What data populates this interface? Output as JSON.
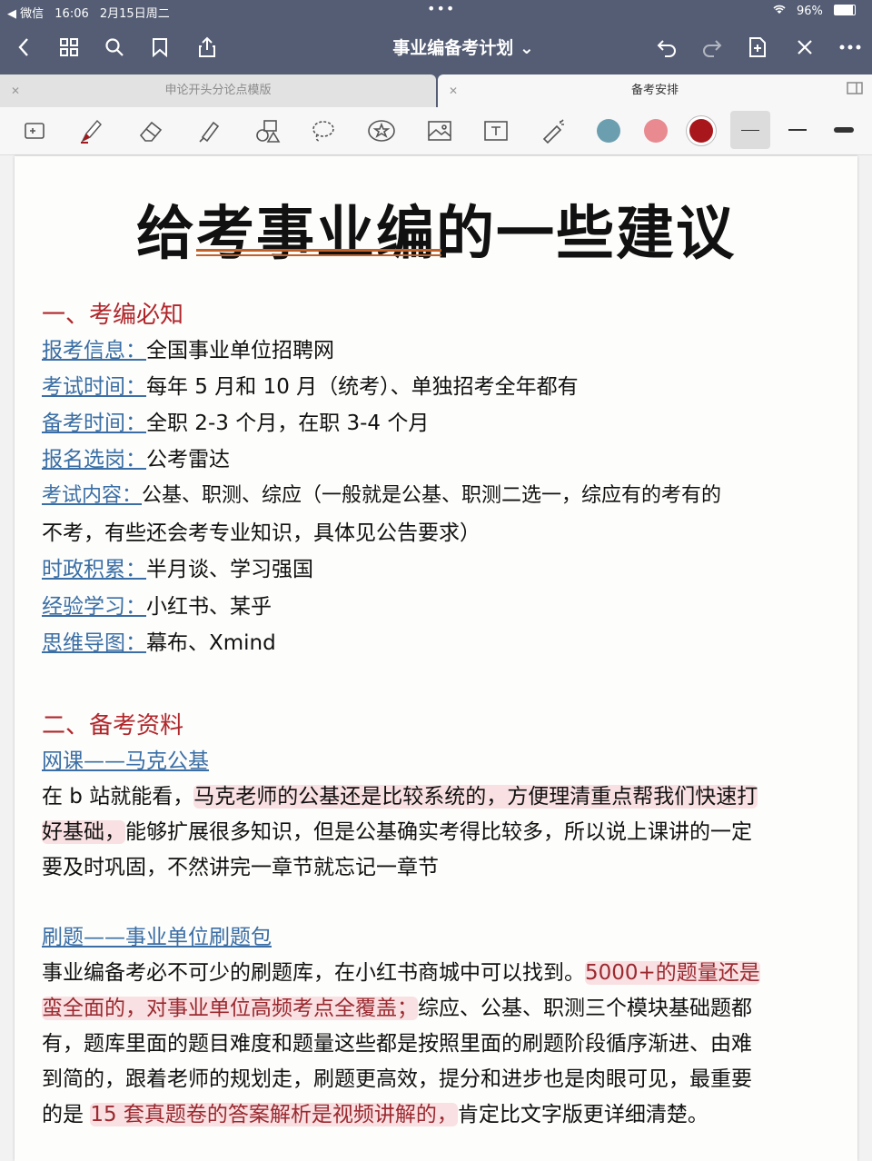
{
  "status_bar": {
    "back_app": "◀ 微信",
    "time": "16:06",
    "date": "2月15日周二",
    "dots": "•••",
    "battery": "96%"
  },
  "nav": {
    "title": "事业编备考计划 ⌄"
  },
  "tabs": [
    {
      "label": "申论开头分论点模版"
    },
    {
      "label": "备考安排"
    }
  ],
  "toolbar": {
    "colors": [
      "#6b9fb0",
      "#e88a90",
      "#a8171b"
    ]
  },
  "doc": {
    "title": "给考事业编的一些建议",
    "section1": {
      "heading": "一、考编必知",
      "items": [
        {
          "key": "报考信息：",
          "value": "全国事业单位招聘网"
        },
        {
          "key": "考试时间：",
          "value": "每年 5 月和 10 月（统考）、单独招考全年都有"
        },
        {
          "key": "备考时间：",
          "value": "全职 2-3 个月，在职 3-4 个月"
        },
        {
          "key": "报名选岗：",
          "value": "公考雷达"
        },
        {
          "key": "考试内容：",
          "value": "公基、职测、综应（一般就是公基、职测二选一，综应有的考有的"
        },
        {
          "key": "",
          "value": "不考，有些还会考专业知识，具体见公告要求）"
        },
        {
          "key": "时政积累：",
          "value": "半月谈、学习强国"
        },
        {
          "key": "经验学习：",
          "value": "小红书、某乎"
        },
        {
          "key": "思维导图：",
          "value": "幕布、Xmind"
        }
      ]
    },
    "section2": {
      "heading": "二、备考资料",
      "sub1": "网课——马克公基",
      "para1": {
        "l1a": "在 b 站就能看，",
        "l1b": "马克老师的公基还是比较系统的，方便理清重点帮我们快速打",
        "l2a": "好基础，",
        "l2b": "能够扩展很多知识，但是公基确实考得比较多，所以说上课讲的一定",
        "l3": "要及时巩固，不然讲完一章节就忘记一章节"
      },
      "sub2": "刷题——事业单位刷题包",
      "para2": {
        "l1a": "事业编备考必不可少的刷题库，在小红书商城中可以找到。",
        "l1b": "5000+的题量还是",
        "l2": "蛮全面的，对事业单位高频考点全覆盖；",
        "l2b": "综应、公基、职测三个模块基础题都",
        "l3": "有，题库里面的题目难度和题量这些都是按照里面的刷题阶段循序渐进、由难",
        "l4": "到简的，跟着老师的规划走，刷题更高效，提分和进步也是肉眼可见，最重要",
        "l5a": "的是 ",
        "l5b": "15 套真题卷的答案解析是视频讲解的，",
        "l5c": "肯定比文字版更详细清楚。"
      }
    }
  }
}
